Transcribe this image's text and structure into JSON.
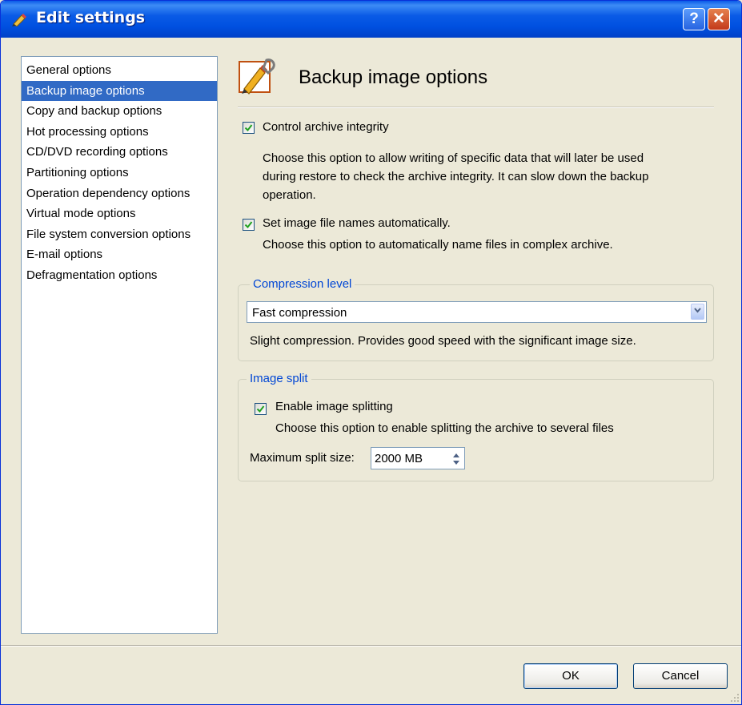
{
  "window": {
    "title": "Edit settings",
    "help_label": "?",
    "close_label": "✕"
  },
  "sidebar": {
    "items": [
      {
        "label": "General options"
      },
      {
        "label": "Backup image options",
        "selected": true
      },
      {
        "label": "Copy and backup options"
      },
      {
        "label": "Hot processing options"
      },
      {
        "label": "CD/DVD recording options"
      },
      {
        "label": "Partitioning options"
      },
      {
        "label": "Operation dependency options"
      },
      {
        "label": "Virtual mode options"
      },
      {
        "label": "File system conversion options"
      },
      {
        "label": "E-mail options"
      },
      {
        "label": "Defragmentation options"
      }
    ]
  },
  "main": {
    "heading": "Backup image options",
    "control_integrity": {
      "label": "Control archive integrity",
      "checked": true,
      "description_lines": [
        "Choose this option to allow writing of specific data that will later be used",
        "during restore to check the archive integrity. It can slow down the backup",
        "operation."
      ]
    },
    "auto_names": {
      "label": "Set image file names automatically.",
      "checked": true,
      "description": "Choose this option to automatically name files in complex archive."
    },
    "compression": {
      "group_title": "Compression level",
      "selected": "Fast compression",
      "description": "Slight compression. Provides good speed with the significant image size."
    },
    "split": {
      "group_title": "Image split",
      "enable_label": "Enable image splitting",
      "enable_checked": true,
      "description": "Choose this option to enable splitting the archive to several files",
      "max_size_label": "Maximum split size:",
      "max_size_value": "2000 MB"
    }
  },
  "footer": {
    "ok_label": "OK",
    "cancel_label": "Cancel"
  },
  "colors": {
    "titlebar": "#0a5be6",
    "selection": "#316ac5",
    "group_title": "#0046d5",
    "dialog_bg": "#ece9d8"
  }
}
